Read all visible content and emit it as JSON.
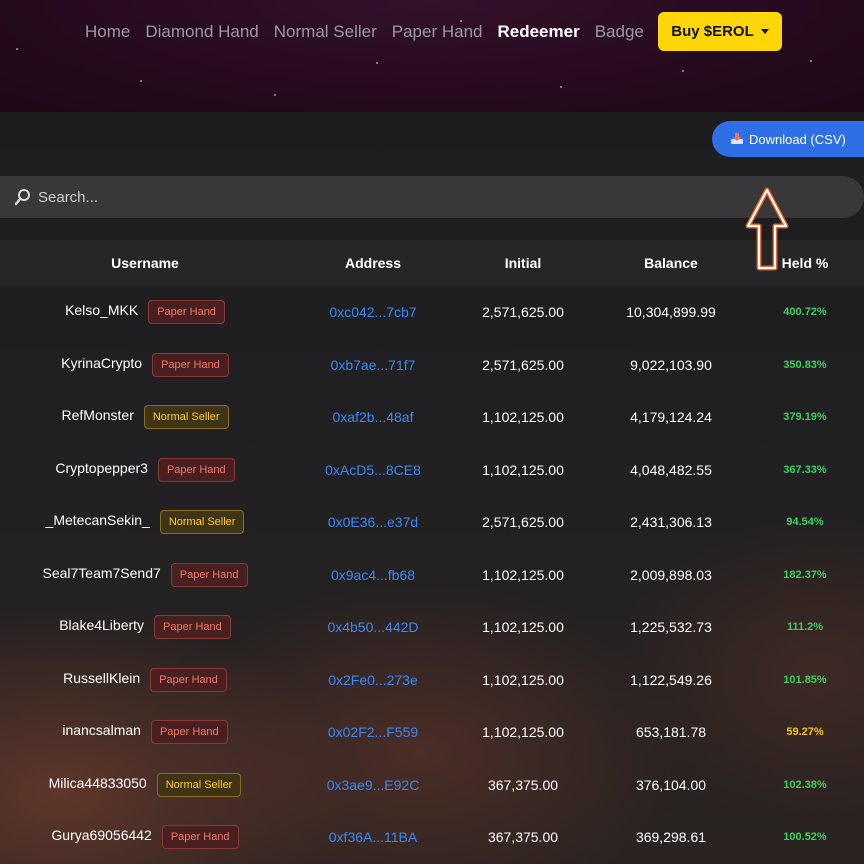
{
  "nav": {
    "links": [
      "Home",
      "Diamond Hand",
      "Normal Seller",
      "Paper Hand",
      "Redeemer",
      "Badge"
    ],
    "active": "Redeemer",
    "buy_label": "Buy $EROL"
  },
  "toolbar": {
    "download_label": "Download (CSV)",
    "search_placeholder": "Search..."
  },
  "table": {
    "headers": [
      "Username",
      "Address",
      "Initial",
      "Balance",
      "Held %"
    ],
    "rows": [
      {
        "username": "Kelso_MKK",
        "badge": "Paper Hand",
        "address": "0xc042...7cb7",
        "initial": "2,571,625.00",
        "balance": "10,304,899.99",
        "held": "400.72%"
      },
      {
        "username": "KyrinaCrypto",
        "badge": "Paper Hand",
        "address": "0xb7ae...71f7",
        "initial": "2,571,625.00",
        "balance": "9,022,103.90",
        "held": "350.83%"
      },
      {
        "username": "RefMonster",
        "badge": "Normal Seller",
        "address": "0xaf2b...48af",
        "initial": "1,102,125.00",
        "balance": "4,179,124.24",
        "held": "379.19%"
      },
      {
        "username": "Cryptopepper3",
        "badge": "Paper Hand",
        "address": "0xAcD5...8CE8",
        "initial": "1,102,125.00",
        "balance": "4,048,482.55",
        "held": "367.33%"
      },
      {
        "username": "_MetecanSekin_",
        "badge": "Normal Seller",
        "address": "0x0E36...e37d",
        "initial": "2,571,625.00",
        "balance": "2,431,306.13",
        "held": "94.54%"
      },
      {
        "username": "Seal7Team7Send7",
        "badge": "Paper Hand",
        "address": "0x9ac4...fb68",
        "initial": "1,102,125.00",
        "balance": "2,009,898.03",
        "held": "182.37%"
      },
      {
        "username": "Blake4Liberty",
        "badge": "Paper Hand",
        "address": "0x4b50...442D",
        "initial": "1,102,125.00",
        "balance": "1,225,532.73",
        "held": "111.2%"
      },
      {
        "username": "RussellKlein",
        "badge": "Paper Hand",
        "address": "0x2Fe0...273e",
        "initial": "1,102,125.00",
        "balance": "1,122,549.26",
        "held": "101.85%"
      },
      {
        "username": "inancsalman",
        "badge": "Paper Hand",
        "address": "0x02F2...F559",
        "initial": "1,102,125.00",
        "balance": "653,181.78",
        "held": "59.27%"
      },
      {
        "username": "Milica44833050",
        "badge": "Normal Seller",
        "address": "0x3ae9...E92C",
        "initial": "367,375.00",
        "balance": "376,104.00",
        "held": "102.38%"
      },
      {
        "username": "Gurya69056442",
        "badge": "Paper Hand",
        "address": "0xf36A...11BA",
        "initial": "367,375.00",
        "balance": "369,298.61",
        "held": "100.52%"
      }
    ]
  },
  "colors": {
    "accent_blue": "#2f6fe6",
    "buy_yellow": "#ffd60a",
    "held_green": "#3ecf5f",
    "held_yellow": "#f5c518"
  }
}
